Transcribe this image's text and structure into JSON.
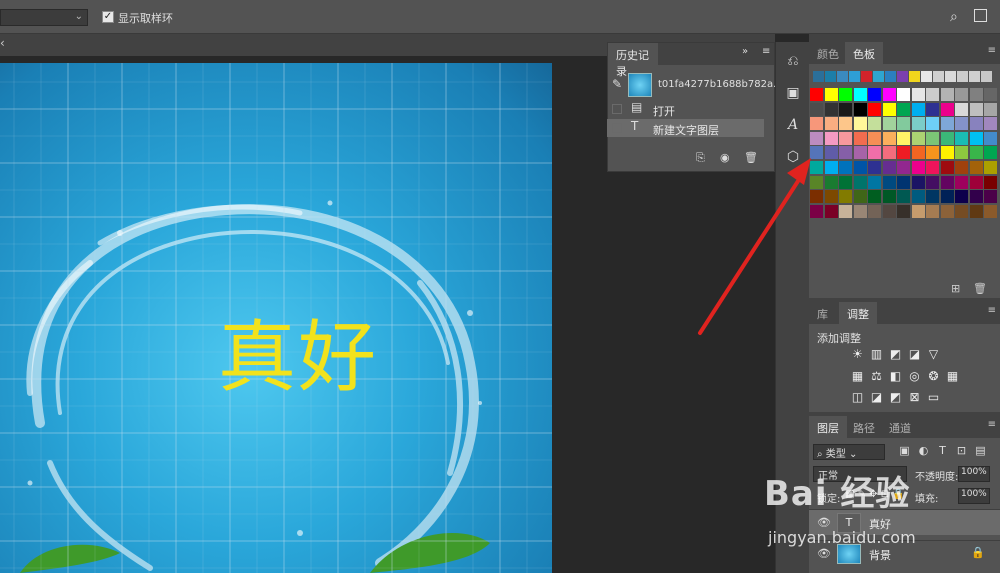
{
  "options_bar": {
    "sample_all_layers_label": "显示取样环",
    "sample_all_layers_checked": true
  },
  "history_panel": {
    "tab_label": "历史记录",
    "snapshot_name": "t01fa4277b1688b782a...",
    "steps": [
      {
        "icon": "document-icon",
        "label": "打开"
      },
      {
        "icon": "type-icon",
        "label": "新建文字图层"
      }
    ]
  },
  "canvas": {
    "text": "真好",
    "text_color": "#f2e21c",
    "background_color": "#2aa7da"
  },
  "swatch_panel": {
    "tabs": [
      "颜色",
      "色板"
    ],
    "active_tab": "色板",
    "recent": [
      "#2b6f9a",
      "#1c7ea8",
      "#3a8abf",
      "#2e9fd6",
      "#d3232a",
      "#2ea5cf",
      "#2b7fbf",
      "#7b3fae",
      "#f1d61c",
      "#e6e6e6",
      "#cfcfcf",
      "#d9d9d9",
      "#cccccc",
      "#d0d0d0",
      "#c8c8c8"
    ],
    "grid": [
      [
        "#ff0000",
        "#ffff00",
        "#00ff00",
        "#00ffff",
        "#0000ff",
        "#ff00ff",
        "#ffffff",
        "#e6e6e6",
        "#cccccc",
        "#b3b3b3",
        "#999999",
        "#808080",
        "#666666"
      ],
      [
        "#4d4d4d",
        "#333333",
        "#1a1a1a",
        "#000000",
        "#ff0000",
        "#ffff00",
        "#00a651",
        "#00aeef",
        "#2e3192",
        "#ec008c",
        "#d9d9d9",
        "#bfbfbf",
        "#a6a6a6"
      ],
      [
        "#f7977a",
        "#f9ad81",
        "#fdc68a",
        "#fff79a",
        "#c4df9b",
        "#a2d39c",
        "#82ca9d",
        "#7bcdc8",
        "#6ecff6",
        "#7ea7d8",
        "#8493ca",
        "#8882be",
        "#a187be"
      ],
      [
        "#bc8cbf",
        "#f49ac2",
        "#f6989d",
        "#f26c4f",
        "#f68e56",
        "#fbaf5c",
        "#fff467",
        "#acd372",
        "#7cc576",
        "#3bb878",
        "#1abbb4",
        "#00bff3",
        "#438ccb"
      ],
      [
        "#5574b9",
        "#605ca8",
        "#855fa8",
        "#a763a8",
        "#f06ea9",
        "#f26d7d",
        "#ed1c24",
        "#f26522",
        "#f7941d",
        "#fff200",
        "#8dc73f",
        "#39b54a",
        "#00a651"
      ],
      [
        "#00a99d",
        "#00aeef",
        "#0072bc",
        "#0054a6",
        "#2e3192",
        "#662d91",
        "#92278f",
        "#ec008c",
        "#ed145b",
        "#9e0b0f",
        "#a0410d",
        "#a3620a",
        "#aba000"
      ],
      [
        "#598527",
        "#197b30",
        "#007236",
        "#00746b",
        "#0076a3",
        "#004a80",
        "#003471",
        "#1b1464",
        "#440e62",
        "#630460",
        "#9e005d",
        "#9e0039",
        "#790000"
      ],
      [
        "#7b2e00",
        "#7d4900",
        "#827b00",
        "#406618",
        "#005e20",
        "#005826",
        "#005952",
        "#005b7f",
        "#003663",
        "#002157",
        "#0d004c",
        "#32004b",
        "#4b0049"
      ],
      [
        "#7b0046",
        "#7a0026",
        "#c7b299",
        "#998675",
        "#736357",
        "#534741",
        "#37302a",
        "#c69c6d",
        "#a67c52",
        "#8c6239",
        "#754c24",
        "#603913",
        "#8b5a2b"
      ]
    ]
  },
  "adjust_panel": {
    "tabs": [
      "库",
      "调整"
    ],
    "active_tab": "调整",
    "title": "添加调整"
  },
  "layers_panel": {
    "tabs": [
      "图层",
      "路径",
      "通道"
    ],
    "active_tab": "图层",
    "filter_label": "类型",
    "blend_mode": "正常",
    "opacity_label": "不透明度:",
    "opacity_value": "100%",
    "lock_label": "锁定:",
    "fill_label": "填充:",
    "fill_value": "100%",
    "layers": [
      {
        "name": "真好",
        "type": "text"
      },
      {
        "name": "背景",
        "type": "image"
      }
    ]
  },
  "watermark": {
    "logo": "Bai 经验",
    "url": "jingyan.baidu.com"
  },
  "colors": {
    "panel_bg": "#535353",
    "panel_dark": "#424242",
    "workspace": "#282828",
    "arrow": "#e0231f"
  }
}
